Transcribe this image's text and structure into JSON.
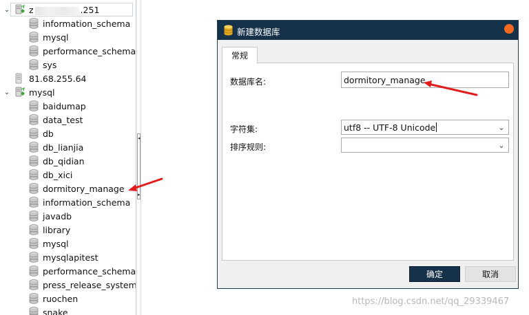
{
  "tree": {
    "top_connection": {
      "label_prefix": "z",
      "label_suffix": ".251"
    },
    "items_group1": [
      "information_schema",
      "mysql",
      "performance_schema",
      "sys"
    ],
    "server_plain": "81.68.255.64",
    "mysql_connection": "mysql",
    "items_group2": [
      "baidumap",
      "data_test",
      "db",
      "db_lianjia",
      "db_qidian",
      "db_xici",
      "dormitory_manage",
      "information_schema",
      "javadb",
      "library",
      "mysql",
      "mysqlapitest",
      "performance_schema",
      "press_release_system",
      "ruochen",
      "snake"
    ]
  },
  "dialog": {
    "title": "新建数据库",
    "tab": "常规",
    "fields": {
      "db_name_label": "数据库名:",
      "db_name_value": "dormitory_manage",
      "charset_label": "字符集:",
      "charset_value": "utf8 -- UTF-8 Unicode",
      "collation_label": "排序规则:",
      "collation_value": ""
    },
    "ok_label": "确定",
    "cancel_label": "取消"
  },
  "watermark": "https://blog.csdn.net/qq_29339467",
  "colors": {
    "title_bar": "#16324a",
    "close_button": "#f26a21",
    "arrow": "#e21c1c"
  }
}
